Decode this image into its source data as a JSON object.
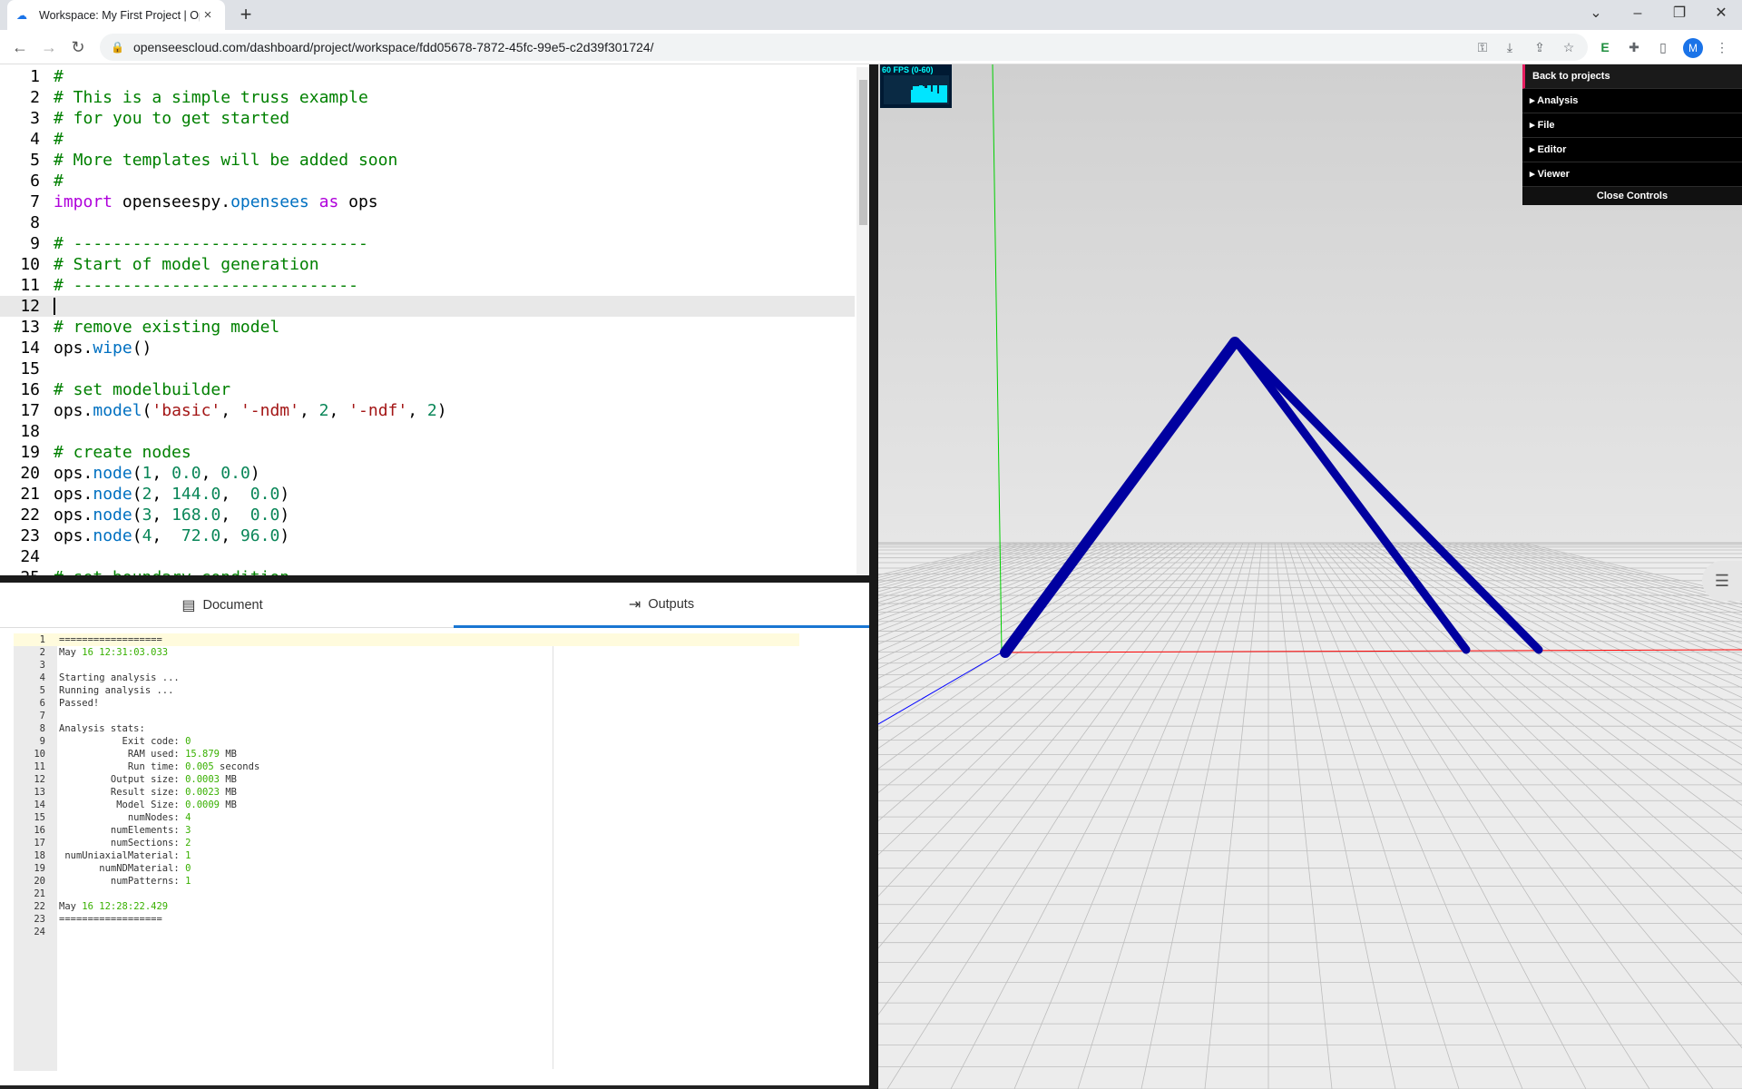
{
  "browser": {
    "tab_title": "Workspace: My First Project | Op",
    "url": "openseescloud.com/dashboard/project/workspace/fdd05678-7872-45fc-99e5-c2d39f301724/"
  },
  "editor": {
    "lines": [
      {
        "num": "1",
        "parts": [
          {
            "t": "#",
            "c": "c"
          }
        ]
      },
      {
        "num": "2",
        "parts": [
          {
            "t": "# This is a simple truss example",
            "c": "c"
          }
        ]
      },
      {
        "num": "3",
        "parts": [
          {
            "t": "# for you to get started",
            "c": "c"
          }
        ]
      },
      {
        "num": "4",
        "parts": [
          {
            "t": "#",
            "c": "c"
          }
        ]
      },
      {
        "num": "5",
        "parts": [
          {
            "t": "# More templates will be added soon",
            "c": "c"
          }
        ]
      },
      {
        "num": "6",
        "parts": [
          {
            "t": "#",
            "c": "c"
          }
        ]
      },
      {
        "num": "7",
        "parts": [
          {
            "t": "import",
            "c": "k"
          },
          {
            "t": " openseespy.",
            "c": "p"
          },
          {
            "t": "opensees",
            "c": "f"
          },
          {
            "t": " as",
            "c": "k"
          },
          {
            "t": " ops",
            "c": "p"
          }
        ]
      },
      {
        "num": "8",
        "parts": []
      },
      {
        "num": "9",
        "parts": [
          {
            "t": "# ------------------------------",
            "c": "c"
          }
        ]
      },
      {
        "num": "10",
        "parts": [
          {
            "t": "# Start of model generation",
            "c": "c"
          }
        ]
      },
      {
        "num": "11",
        "parts": [
          {
            "t": "# -----------------------------",
            "c": "c"
          }
        ]
      },
      {
        "num": "12",
        "parts": []
      },
      {
        "num": "13",
        "parts": [
          {
            "t": "# remove existing model",
            "c": "c"
          }
        ]
      },
      {
        "num": "14",
        "parts": [
          {
            "t": "ops.",
            "c": "p"
          },
          {
            "t": "wipe",
            "c": "f"
          },
          {
            "t": "()",
            "c": "p"
          }
        ]
      },
      {
        "num": "15",
        "parts": []
      },
      {
        "num": "16",
        "parts": [
          {
            "t": "# set modelbuilder",
            "c": "c"
          }
        ]
      },
      {
        "num": "17",
        "parts": [
          {
            "t": "ops.",
            "c": "p"
          },
          {
            "t": "model",
            "c": "f"
          },
          {
            "t": "(",
            "c": "p"
          },
          {
            "t": "'basic'",
            "c": "s"
          },
          {
            "t": ", ",
            "c": "p"
          },
          {
            "t": "'-ndm'",
            "c": "s"
          },
          {
            "t": ", ",
            "c": "p"
          },
          {
            "t": "2",
            "c": "n"
          },
          {
            "t": ", ",
            "c": "p"
          },
          {
            "t": "'-ndf'",
            "c": "s"
          },
          {
            "t": ", ",
            "c": "p"
          },
          {
            "t": "2",
            "c": "n"
          },
          {
            "t": ")",
            "c": "p"
          }
        ]
      },
      {
        "num": "18",
        "parts": []
      },
      {
        "num": "19",
        "parts": [
          {
            "t": "# create nodes",
            "c": "c"
          }
        ]
      },
      {
        "num": "20",
        "parts": [
          {
            "t": "ops.",
            "c": "p"
          },
          {
            "t": "node",
            "c": "f"
          },
          {
            "t": "(",
            "c": "p"
          },
          {
            "t": "1",
            "c": "n"
          },
          {
            "t": ", ",
            "c": "p"
          },
          {
            "t": "0.0",
            "c": "n"
          },
          {
            "t": ", ",
            "c": "p"
          },
          {
            "t": "0.0",
            "c": "n"
          },
          {
            "t": ")",
            "c": "p"
          }
        ]
      },
      {
        "num": "21",
        "parts": [
          {
            "t": "ops.",
            "c": "p"
          },
          {
            "t": "node",
            "c": "f"
          },
          {
            "t": "(",
            "c": "p"
          },
          {
            "t": "2",
            "c": "n"
          },
          {
            "t": ", ",
            "c": "p"
          },
          {
            "t": "144.0",
            "c": "n"
          },
          {
            "t": ",  ",
            "c": "p"
          },
          {
            "t": "0.0",
            "c": "n"
          },
          {
            "t": ")",
            "c": "p"
          }
        ]
      },
      {
        "num": "22",
        "parts": [
          {
            "t": "ops.",
            "c": "p"
          },
          {
            "t": "node",
            "c": "f"
          },
          {
            "t": "(",
            "c": "p"
          },
          {
            "t": "3",
            "c": "n"
          },
          {
            "t": ", ",
            "c": "p"
          },
          {
            "t": "168.0",
            "c": "n"
          },
          {
            "t": ",  ",
            "c": "p"
          },
          {
            "t": "0.0",
            "c": "n"
          },
          {
            "t": ")",
            "c": "p"
          }
        ]
      },
      {
        "num": "23",
        "parts": [
          {
            "t": "ops.",
            "c": "p"
          },
          {
            "t": "node",
            "c": "f"
          },
          {
            "t": "(",
            "c": "p"
          },
          {
            "t": "4",
            "c": "n"
          },
          {
            "t": ",  ",
            "c": "p"
          },
          {
            "t": "72.0",
            "c": "n"
          },
          {
            "t": ", ",
            "c": "p"
          },
          {
            "t": "96.0",
            "c": "n"
          },
          {
            "t": ")",
            "c": "p"
          }
        ]
      },
      {
        "num": "24",
        "parts": []
      },
      {
        "num": "25",
        "parts": [
          {
            "t": "# set boundary condition",
            "c": "c"
          }
        ]
      }
    ]
  },
  "bottom_tabs": {
    "document": "Document",
    "outputs": "Outputs"
  },
  "output": {
    "lines": [
      {
        "num": "1",
        "parts": [
          {
            "t": "==================",
            "c": ""
          }
        ]
      },
      {
        "num": "2",
        "parts": [
          {
            "t": "May ",
            "c": ""
          },
          {
            "t": "16 12:31:03.033",
            "c": "g"
          }
        ]
      },
      {
        "num": "3",
        "parts": []
      },
      {
        "num": "4",
        "parts": [
          {
            "t": "Starting analysis ...",
            "c": ""
          }
        ]
      },
      {
        "num": "5",
        "parts": [
          {
            "t": "Running analysis ...",
            "c": ""
          }
        ]
      },
      {
        "num": "6",
        "parts": [
          {
            "t": "Passed!",
            "c": ""
          }
        ]
      },
      {
        "num": "7",
        "parts": []
      },
      {
        "num": "8",
        "parts": [
          {
            "t": "Analysis stats:",
            "c": ""
          }
        ]
      },
      {
        "num": "9",
        "parts": [
          {
            "t": "           Exit code: ",
            "c": ""
          },
          {
            "t": "0",
            "c": "g"
          }
        ]
      },
      {
        "num": "10",
        "parts": [
          {
            "t": "            RAM used: ",
            "c": ""
          },
          {
            "t": "15.879",
            "c": "g"
          },
          {
            "t": " MB",
            "c": ""
          }
        ]
      },
      {
        "num": "11",
        "parts": [
          {
            "t": "            Run time: ",
            "c": ""
          },
          {
            "t": "0.005",
            "c": "g"
          },
          {
            "t": " seconds",
            "c": ""
          }
        ]
      },
      {
        "num": "12",
        "parts": [
          {
            "t": "         Output size: ",
            "c": ""
          },
          {
            "t": "0.0003",
            "c": "g"
          },
          {
            "t": " MB",
            "c": ""
          }
        ]
      },
      {
        "num": "13",
        "parts": [
          {
            "t": "         Result size: ",
            "c": ""
          },
          {
            "t": "0.0023",
            "c": "g"
          },
          {
            "t": " MB",
            "c": ""
          }
        ]
      },
      {
        "num": "14",
        "parts": [
          {
            "t": "          Model Size: ",
            "c": ""
          },
          {
            "t": "0.0009",
            "c": "g"
          },
          {
            "t": " MB",
            "c": ""
          }
        ]
      },
      {
        "num": "15",
        "parts": [
          {
            "t": "            numNodes: ",
            "c": ""
          },
          {
            "t": "4",
            "c": "g"
          }
        ]
      },
      {
        "num": "16",
        "parts": [
          {
            "t": "         numElements: ",
            "c": ""
          },
          {
            "t": "3",
            "c": "g"
          }
        ]
      },
      {
        "num": "17",
        "parts": [
          {
            "t": "         numSections: ",
            "c": ""
          },
          {
            "t": "2",
            "c": "g"
          }
        ]
      },
      {
        "num": "18",
        "parts": [
          {
            "t": " numUniaxialMaterial: ",
            "c": ""
          },
          {
            "t": "1",
            "c": "g"
          }
        ]
      },
      {
        "num": "19",
        "parts": [
          {
            "t": "       numNDMaterial: ",
            "c": ""
          },
          {
            "t": "0",
            "c": "g"
          }
        ]
      },
      {
        "num": "20",
        "parts": [
          {
            "t": "         numPatterns: ",
            "c": ""
          },
          {
            "t": "1",
            "c": "g"
          }
        ]
      },
      {
        "num": "21",
        "parts": []
      },
      {
        "num": "22",
        "parts": [
          {
            "t": "May ",
            "c": ""
          },
          {
            "t": "16 12:28:22.429",
            "c": "g"
          }
        ]
      },
      {
        "num": "23",
        "parts": [
          {
            "t": "==================",
            "c": ""
          }
        ]
      },
      {
        "num": "24",
        "parts": []
      }
    ]
  },
  "viewer": {
    "fps_label": "60 FPS (0-60)",
    "controls": {
      "back": "Back to projects",
      "analysis": "Analysis",
      "file": "File",
      "editor": "Editor",
      "viewer": "Viewer",
      "close": "Close Controls"
    },
    "truss_color": "#0000a0",
    "grid_color": "#bdbdbd"
  }
}
